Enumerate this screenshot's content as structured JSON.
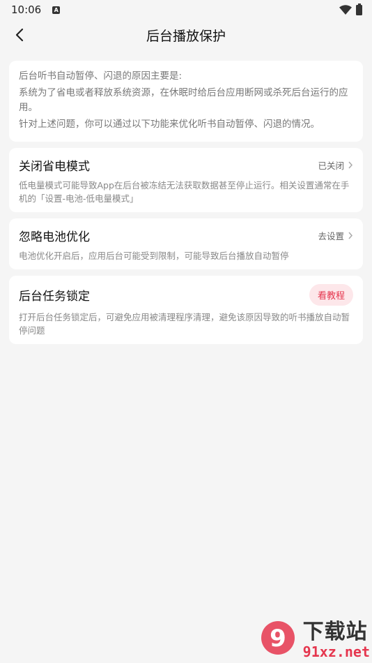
{
  "status_bar": {
    "time": "10:06",
    "notification_icon": "A"
  },
  "header": {
    "title": "后台播放保护"
  },
  "intro": {
    "lines": [
      "后台听书自动暂停、闪退的原因主要是:",
      "系统为了省电或者释放系统资源，在休眠时给后台应用断网或杀死后台运行的应用。",
      "针对上述问题，你可以通过以下功能来优化听书自动暂停、闪退的情况。"
    ]
  },
  "settings": [
    {
      "title": "关闭省电模式",
      "action": "已关闭",
      "description": "低电量模式可能导致App在后台被冻结无法获取数据甚至停止运行。相关设置通常在手机的「设置-电池-低电量模式」"
    },
    {
      "title": "忽略电池优化",
      "action": "去设置",
      "description": "电池优化开启后，应用后台可能受到限制，可能导致后台播放自动暂停"
    },
    {
      "title": "后台任务锁定",
      "action": "看教程",
      "description": "打开后台任务锁定后，可避免应用被清理程序清理，避免该原因导致的听书播放自动暂停问题"
    }
  ],
  "watermark": {
    "logo_text": "9",
    "big": "下载站",
    "small": "91xz.net"
  },
  "colors": {
    "background": "#f5f5f5",
    "accent": "#e5364e",
    "accent_bg": "#fde7ea"
  },
  "icons": [
    "back-arrow-icon",
    "wifi-icon",
    "battery-icon",
    "chevron-right-icon"
  ]
}
